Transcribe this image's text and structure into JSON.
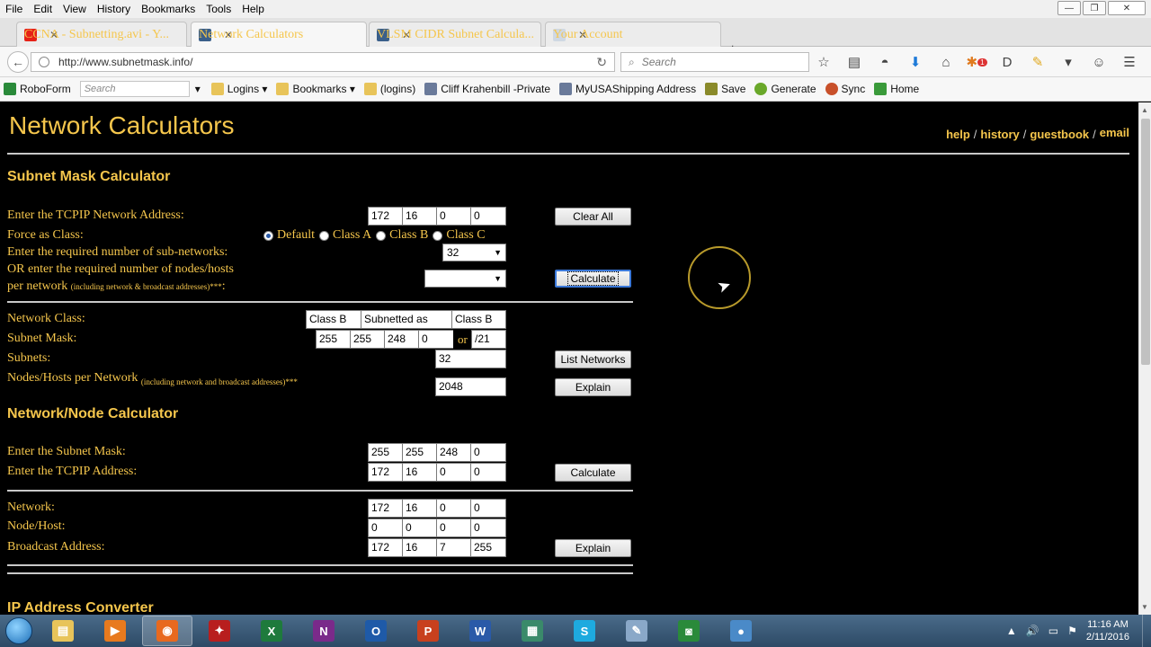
{
  "window": {
    "menu": [
      "File",
      "Edit",
      "View",
      "History",
      "Bookmarks",
      "Tools",
      "Help"
    ],
    "controls": {
      "minimize": "—",
      "maximize": "❐",
      "close": "✕"
    }
  },
  "tabs": [
    {
      "label": "CCNA - Subnetting.avi - Y...",
      "icon_color": "#e62117"
    },
    {
      "label": "Network Calculators",
      "icon_color": "#3a5f8a"
    },
    {
      "label": "VLSM CIDR Subnet Calcula...",
      "icon_color": "#3a5f8a"
    },
    {
      "label": "Your Account",
      "icon_color": "#cfd8e3"
    }
  ],
  "newtab": "+",
  "nav": {
    "url": "http://www.subnetmask.info/",
    "search_placeholder": "Search",
    "badge": "1"
  },
  "bookmarks": {
    "roboform": "RoboForm",
    "search_placeholder": "Search",
    "items": [
      "Logins",
      "Bookmarks",
      "(logins)",
      "Cliff Krahenbill -Private",
      "MyUSAShipping Address",
      "Save",
      "Generate",
      "Sync",
      "Home"
    ]
  },
  "page": {
    "title": "Network Calculators",
    "links": {
      "help": "help",
      "history": "history",
      "guestbook": "guestbook",
      "email": "email"
    },
    "subnet_section": {
      "heading": "Subnet Mask Calculator",
      "network_address_label": "Enter the TCPIP Network Address:",
      "network_address": [
        "172",
        "16",
        "0",
        "0"
      ],
      "clear_button": "Clear All",
      "force_class_label": "Force as Class:",
      "class_options": [
        "Default",
        "Class A",
        "Class B",
        "Class C"
      ],
      "class_selected": "Default",
      "subnets_label": "Enter the required number of sub-networks:",
      "subnets_select": "32",
      "hosts_label_1": "OR enter the required number of nodes/hosts",
      "hosts_label_2": "per network",
      "hosts_note": "(including network & broadcast addresses)***",
      "hosts_select": "",
      "calculate_button": "Calculate",
      "network_class_label": "Network Class:",
      "network_class": [
        "Class B",
        "Subnetted as",
        "Class B"
      ],
      "subnet_mask_label": "Subnet Mask:",
      "subnet_mask": [
        "255",
        "255",
        "248",
        "0"
      ],
      "or": "or",
      "cidr": "/21",
      "subnets_result_label": "Subnets:",
      "subnets_result": "32",
      "list_button": "List Networks",
      "nodes_label": "Nodes/Hosts per Network",
      "nodes_note": "(including network and broadcast addresses)***",
      "nodes_result": "2048",
      "explain_button": "Explain"
    },
    "node_section": {
      "heading": "Network/Node Calculator",
      "mask_label": "Enter the Subnet Mask:",
      "mask": [
        "255",
        "255",
        "248",
        "0"
      ],
      "address_label": "Enter the TCPIP Address:",
      "address": [
        "172",
        "16",
        "0",
        "0"
      ],
      "calculate_button": "Calculate",
      "network_label": "Network:",
      "network": [
        "172",
        "16",
        "0",
        "0"
      ],
      "node_label": "Node/Host:",
      "node": [
        "0",
        "0",
        "0",
        "0"
      ],
      "broadcast_label": "Broadcast Address:",
      "broadcast": [
        "172",
        "16",
        "7",
        "255"
      ],
      "explain_button": "Explain"
    },
    "ip_section": {
      "heading": "IP Address Converter"
    }
  },
  "taskbar": {
    "apps": [
      {
        "name": "explorer",
        "color": "#e8c45a",
        "glyph": "▤"
      },
      {
        "name": "media",
        "color": "#e87a1e",
        "glyph": "▶"
      },
      {
        "name": "firefox",
        "color": "#e8691e",
        "glyph": "◉"
      },
      {
        "name": "app-red",
        "color": "#b81e1e",
        "glyph": "✦"
      },
      {
        "name": "excel",
        "color": "#1e7a3c",
        "glyph": "X"
      },
      {
        "name": "onenote",
        "color": "#7a2a8a",
        "glyph": "N"
      },
      {
        "name": "outlook",
        "color": "#1e5aa8",
        "glyph": "O"
      },
      {
        "name": "powerpoint",
        "color": "#c8401e",
        "glyph": "P"
      },
      {
        "name": "word",
        "color": "#2a5aa8",
        "glyph": "W"
      },
      {
        "name": "app-chart",
        "color": "#3a8a6a",
        "glyph": "▦"
      },
      {
        "name": "skype",
        "color": "#1eaadf",
        "glyph": "S"
      },
      {
        "name": "paint",
        "color": "#8aa8c8",
        "glyph": "✎"
      },
      {
        "name": "roboform",
        "color": "#2a8a3a",
        "glyph": "◙"
      },
      {
        "name": "recorder",
        "color": "#4a8ac8",
        "glyph": "●"
      }
    ],
    "time": "11:16 AM",
    "date": "2/11/2016"
  }
}
